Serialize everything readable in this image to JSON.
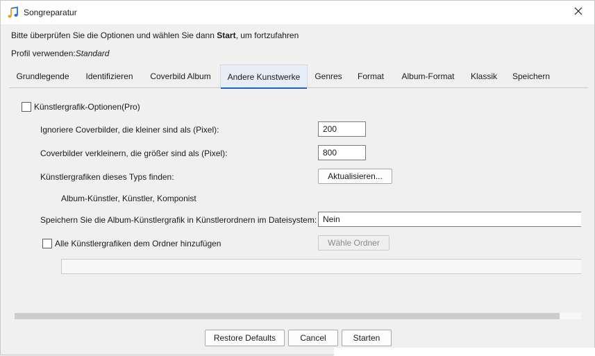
{
  "window": {
    "title": "Songreparatur",
    "app_icon": "music-note-icon",
    "close_icon": "close-icon"
  },
  "header": {
    "instruction_pre": "Bitte überprüfen Sie die Optionen und wählen Sie dann ",
    "instruction_bold": "Start",
    "instruction_post": ", um fortzufahren",
    "profile_label": "Profil verwenden:",
    "profile_value": "Standard"
  },
  "tabs": [
    {
      "label": "Grundlegende",
      "active": false
    },
    {
      "label": "Identifizieren",
      "active": false
    },
    {
      "label": "Coverbild Album",
      "active": false
    },
    {
      "label": "Andere Kunstwerke",
      "active": true
    },
    {
      "label": "Genres",
      "active": false
    },
    {
      "label": "Format",
      "active": false
    },
    {
      "label": "Album-Format",
      "active": false
    },
    {
      "label": "Klassik",
      "active": false
    },
    {
      "label": "Speichern",
      "active": false
    }
  ],
  "options": {
    "artist_options_label": "Künstlergrafik-Optionen(Pro)",
    "artist_options_checked": false,
    "ignore_small_label": "Ignoriere Coverbilder, die kleiner sind als (Pixel):",
    "ignore_small_value": "200",
    "shrink_large_label": "Coverbilder verkleinern, die größer sind als (Pixel):",
    "shrink_large_value": "800",
    "find_types_label": "Künstlergrafiken dieses Typs finden:",
    "update_button": "Aktualisieren...",
    "types_value": "Album-Künstler, Künstler, Komponist",
    "save_folder_label": "Speichern Sie die Album-Künstlergrafik in Künstlerordnern im Dateisystem:",
    "save_folder_value": "Nein",
    "add_all_label": "Alle Künstlergrafiken dem Ordner hinzufügen",
    "add_all_checked": false,
    "choose_folder_button": "Wähle Ordner",
    "folder_path_value": ""
  },
  "footer": {
    "restore_defaults": "Restore Defaults",
    "cancel": "Cancel",
    "start": "Starten"
  },
  "colors": {
    "accent": "#1f5fbf",
    "background": "#f0f0f0"
  }
}
